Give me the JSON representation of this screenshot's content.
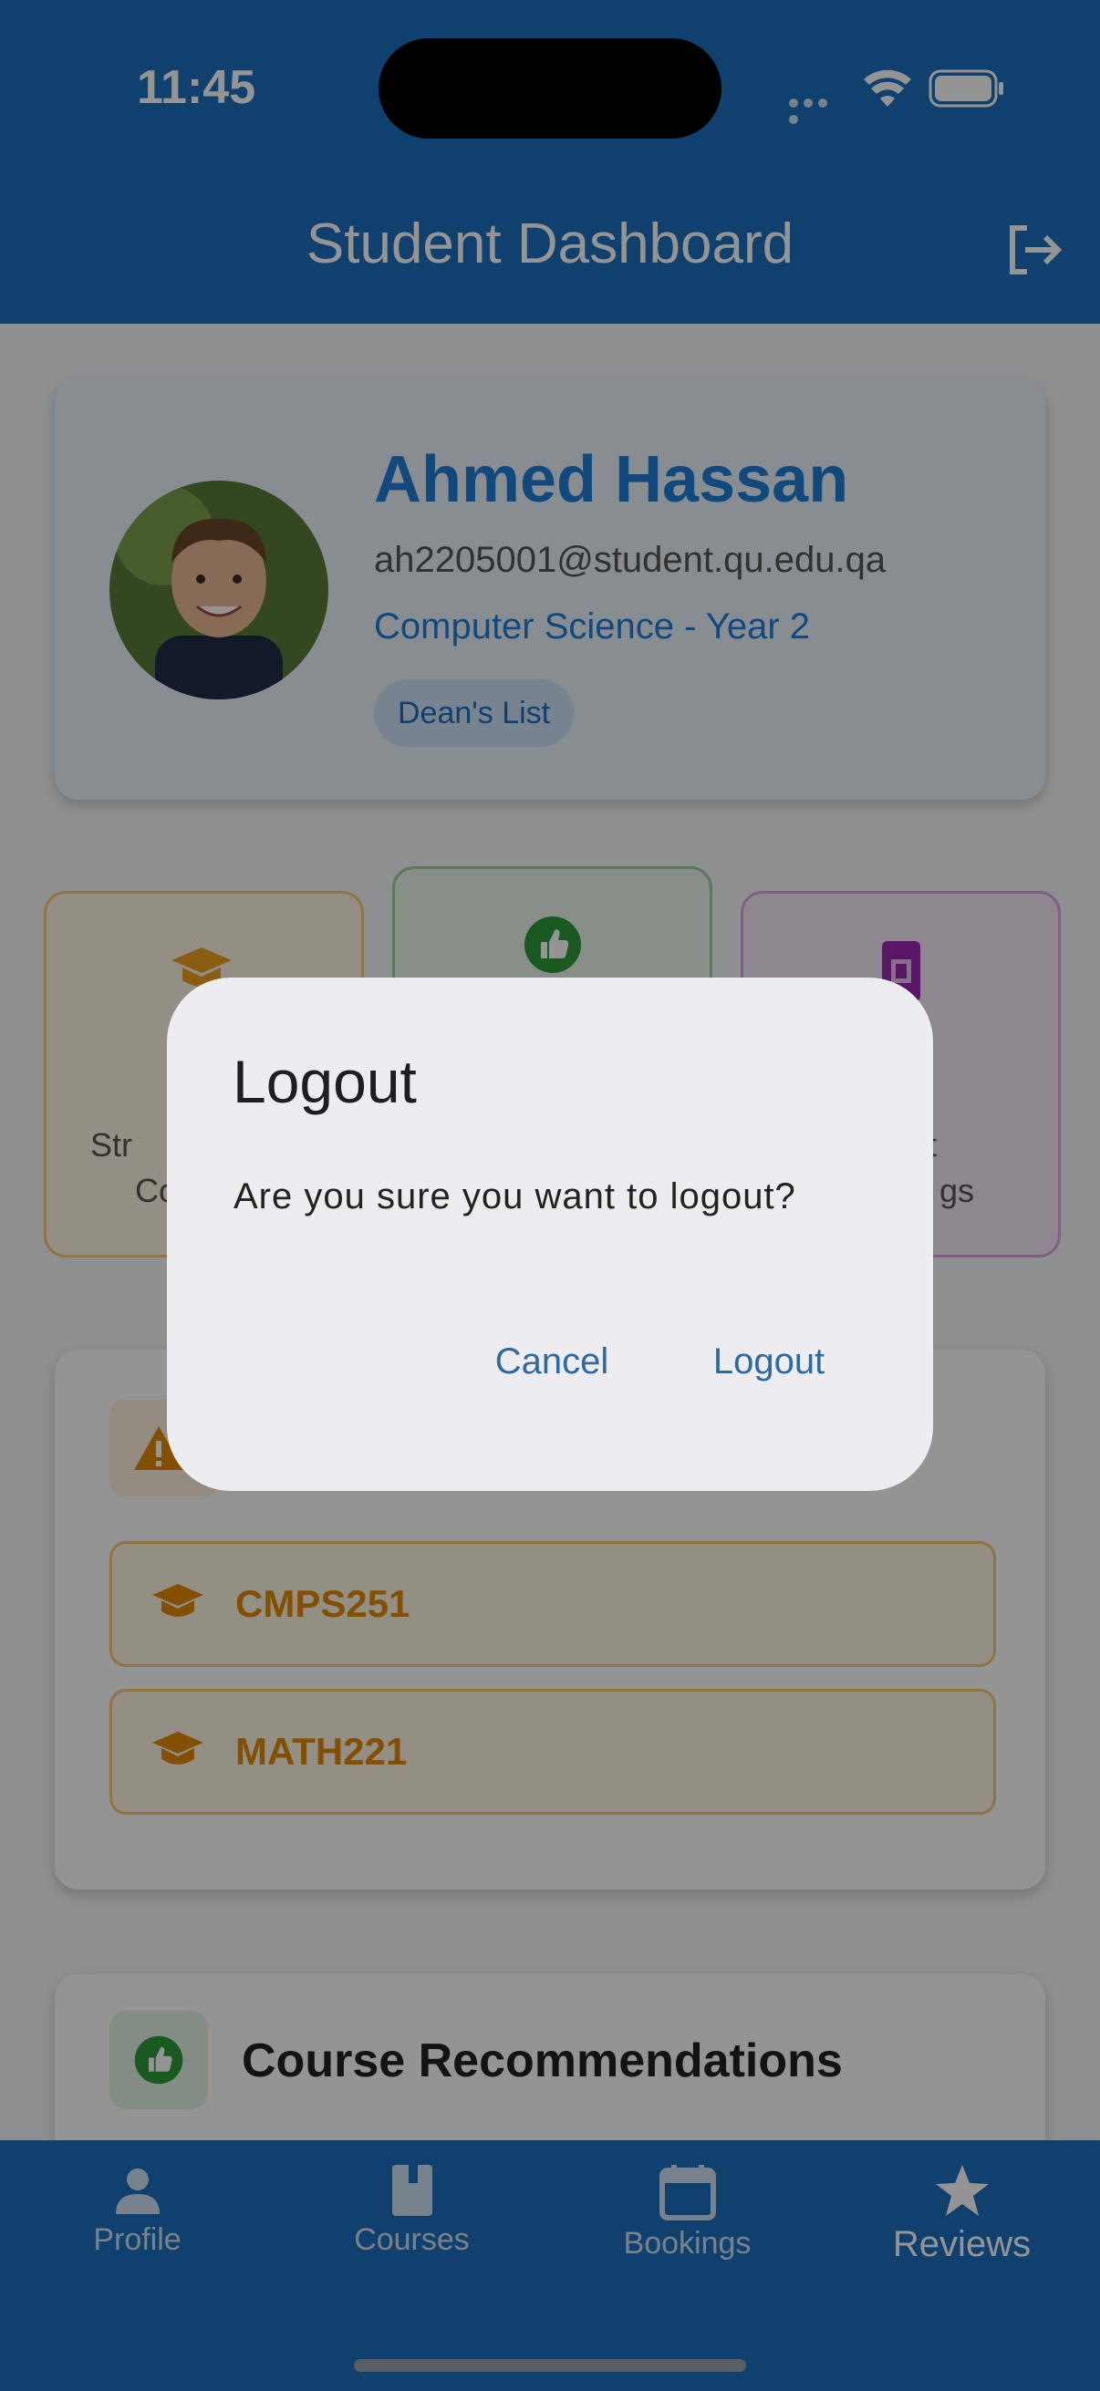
{
  "status_bar": {
    "time": "11:45"
  },
  "app_bar": {
    "title": "Student Dashboard",
    "action_icon": "logout-icon"
  },
  "profile": {
    "name": "Ahmed Hassan",
    "email": "ah2205001@student.qu.edu.qa",
    "program": "Computer Science - Year 2",
    "badge": "Dean's List"
  },
  "tiles": [
    {
      "icon": "graduation-cap-icon",
      "line1": "Str",
      "line2": "Co",
      "color": "#f0a020"
    },
    {
      "icon": "thumbs-up-icon",
      "line1": "",
      "line2": "",
      "color": "#2e9a3a"
    },
    {
      "icon": "booking-icon",
      "line1": "nt",
      "line2": "gs",
      "color": "#9c27b0"
    }
  ],
  "warning_courses": [
    {
      "code": "CMPS251"
    },
    {
      "code": "MATH221"
    }
  ],
  "recommendations": {
    "title": "Course Recommendations"
  },
  "bottom_nav": [
    {
      "label": "Profile",
      "icon": "person-icon"
    },
    {
      "label": "Courses",
      "icon": "book-icon"
    },
    {
      "label": "Bookings",
      "icon": "calendar-icon"
    },
    {
      "label": "Reviews",
      "icon": "star-icon",
      "active": true
    }
  ],
  "dialog": {
    "title": "Logout",
    "message": "Are you sure you want to logout?",
    "cancel_label": "Cancel",
    "confirm_label": "Logout"
  },
  "colors": {
    "primary": "#1a6fbe",
    "accent": "#1e7fd8",
    "warning": "#e08a00",
    "success": "#2e9a3a"
  }
}
